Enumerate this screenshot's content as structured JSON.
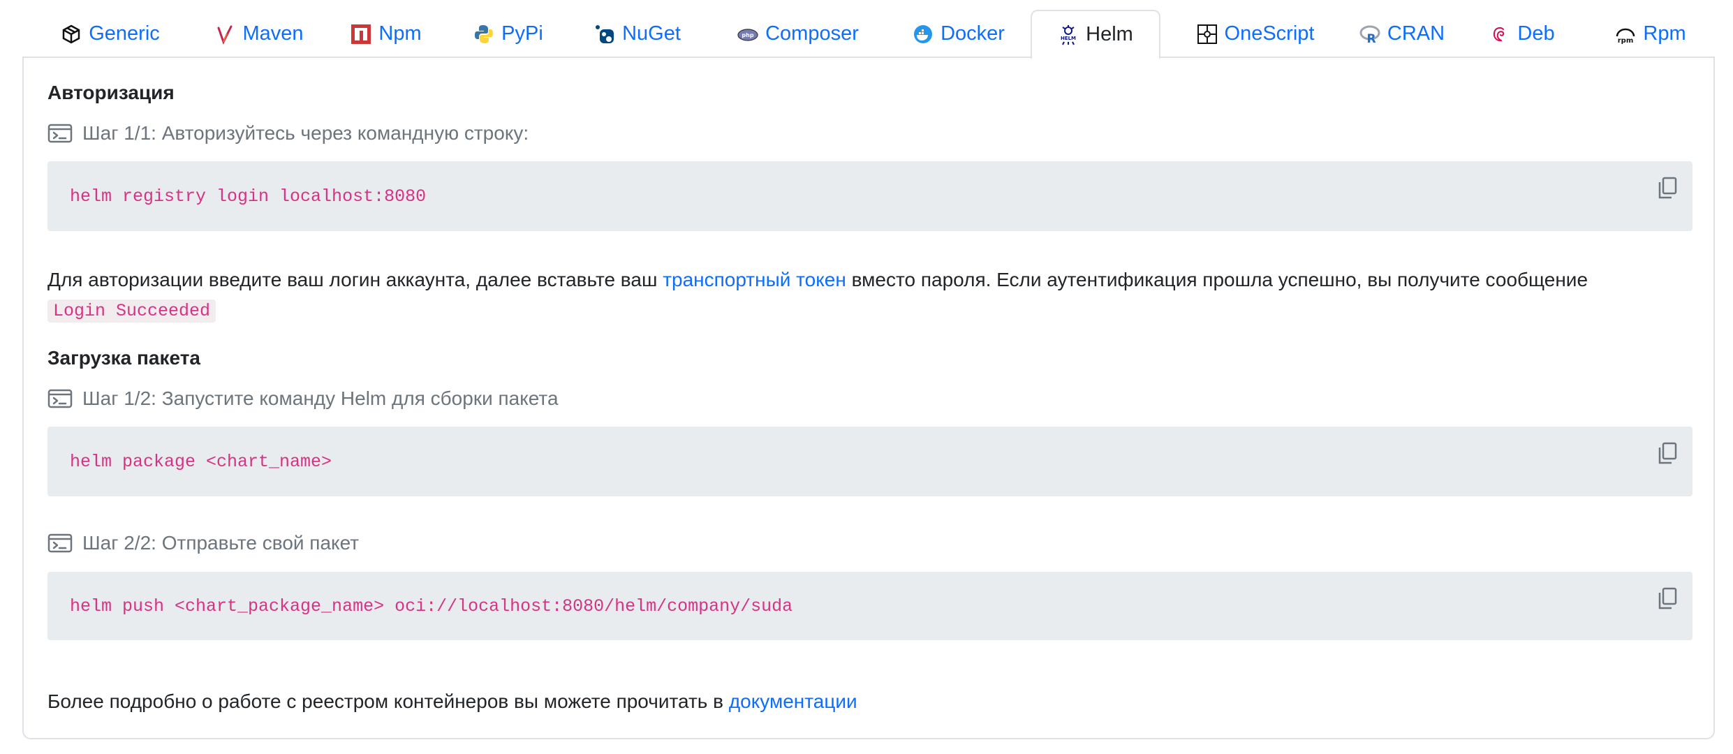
{
  "tabs": [
    {
      "label": "Generic",
      "icon": "package-cube-icon"
    },
    {
      "label": "Maven",
      "icon": "maven-feather-icon"
    },
    {
      "label": "Npm",
      "icon": "npm-logo-icon"
    },
    {
      "label": "PyPi",
      "icon": "python-logo-icon"
    },
    {
      "label": "NuGet",
      "icon": "nuget-logo-icon"
    },
    {
      "label": "Composer",
      "icon": "composer-logo-icon"
    },
    {
      "label": "Docker",
      "icon": "docker-whale-icon"
    },
    {
      "label": "Helm",
      "icon": "helm-wheel-icon",
      "active": true
    },
    {
      "label": "OneScript",
      "icon": "onescript-puzzle-icon"
    },
    {
      "label": "CRAN",
      "icon": "r-logo-icon"
    },
    {
      "label": "Deb",
      "icon": "debian-swirl-icon"
    },
    {
      "label": "Rpm",
      "icon": "rpm-logo-icon"
    }
  ],
  "auth": {
    "heading": "Авторизация",
    "step1": "Шаг 1/1: Авторизуйтесь через командную строку:",
    "command": "helm registry login localhost:8080",
    "desc_before": "Для авторизации введите ваш логин аккаунта, далее вставьте ваш ",
    "desc_link": "транспортный токен",
    "desc_after": " вместо пароля. Если аутентификация прошла успешно, вы получите сообщение",
    "success_message": "Login Succeeded"
  },
  "upload": {
    "heading": "Загрузка пакета",
    "step1": "Шаг 1/2: Запустите команду Helm для сборки пакета",
    "command1": "helm package <chart_name>",
    "step2": "Шаг 2/2: Отправьте свой пакет",
    "command2": "helm push <chart_package_name> oci://localhost:8080/helm/company/suda"
  },
  "footer": {
    "text_before": "Более подробно о работе с реестром контейнеров вы можете прочитать в ",
    "link": "документации"
  },
  "colors": {
    "link": "#0d6efd",
    "code": "#d63384",
    "code_bg": "#e9ecef",
    "muted": "#6c757d",
    "border": "#dee2e6"
  }
}
